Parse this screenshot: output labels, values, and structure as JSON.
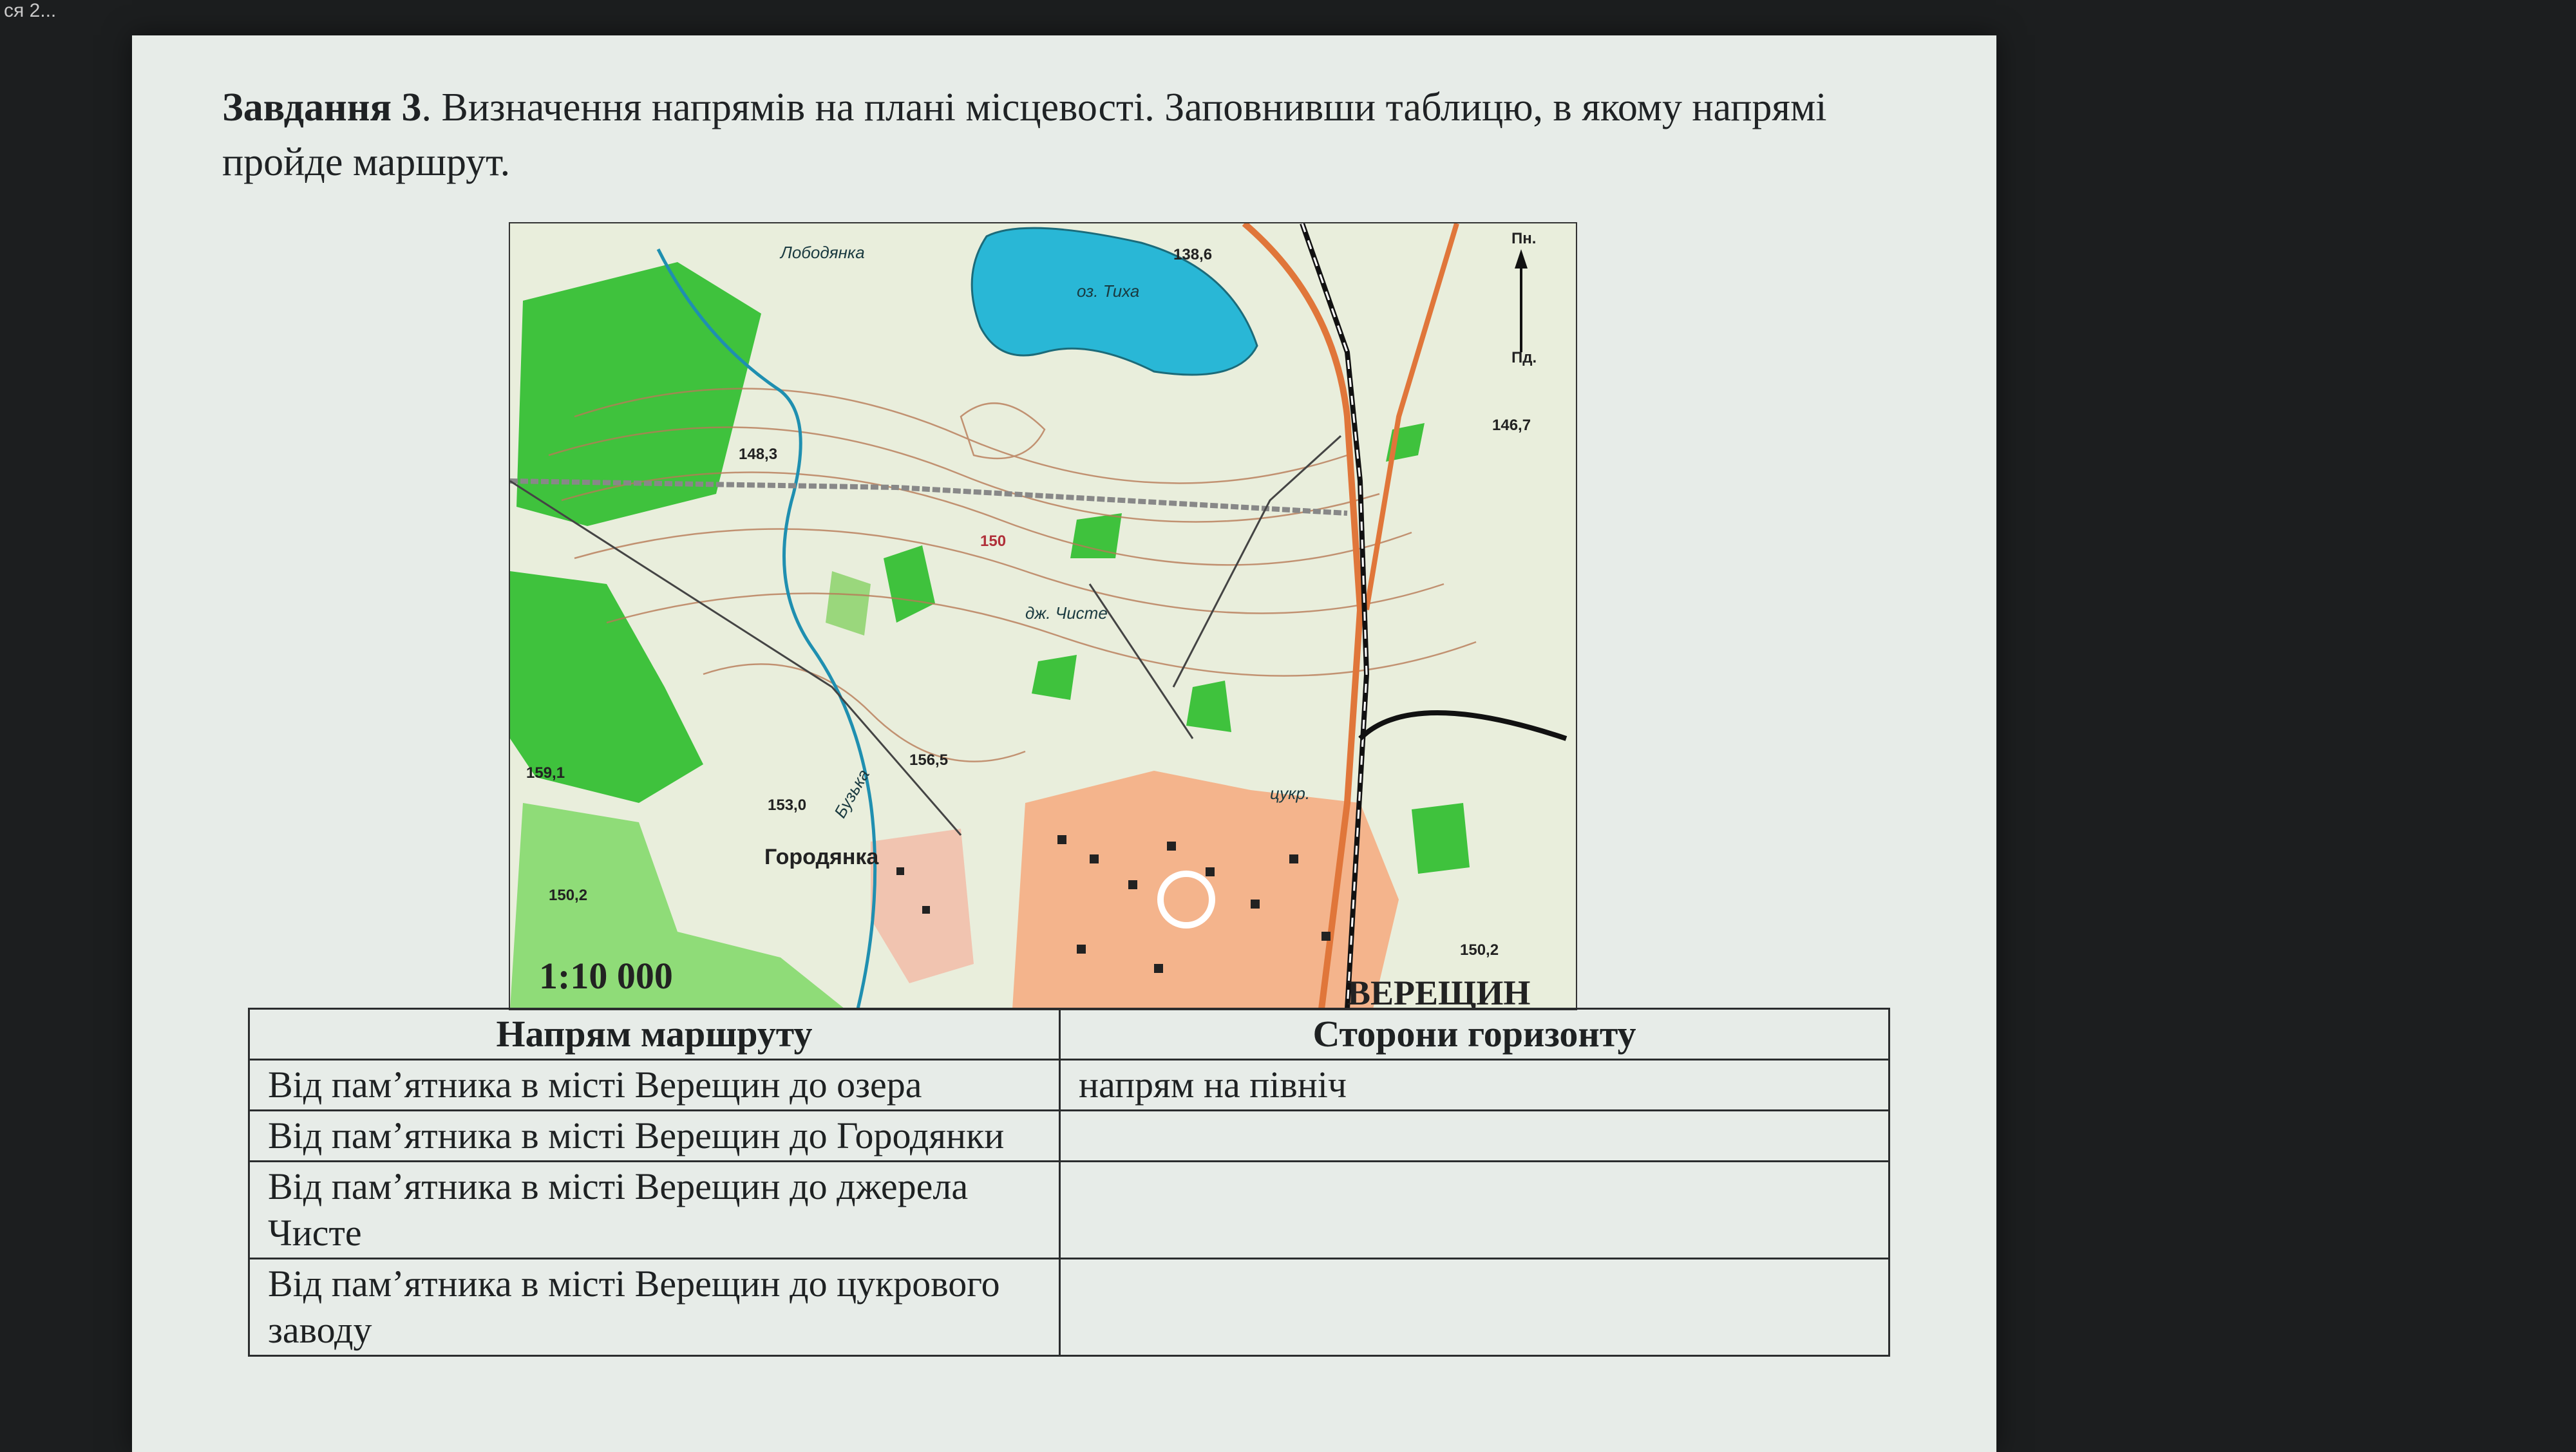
{
  "taskbar": {
    "text": "ся  2..."
  },
  "task": {
    "number_label": "Завдання 3",
    "text": ". Визначення напрямів на плані місцевості. Заповнивши таблицю, в якому напрямі пройде маршрут."
  },
  "map": {
    "scale": "1:10 000",
    "city": "ВЕРЕЩИН",
    "labels": {
      "lobodianka": "Лободянка",
      "lake": "оз. Тиха",
      "h1386": "138,6",
      "h1483": "148,3",
      "h1467": "146,7",
      "spring": "дж. Чисте",
      "h1565": "156,5",
      "h1530": "153,0",
      "h1591": "159,1",
      "h1502a": "150,2",
      "h1502b": "150,2",
      "h150": "150",
      "village": "Городянка",
      "river": "Бузька",
      "sugar": "цукр.",
      "north": "Пн.",
      "south": "Пд."
    }
  },
  "table": {
    "headers": [
      "Напрям маршруту",
      "Сторони горизонту"
    ],
    "rows": [
      {
        "route": "Від пам’ятника в місті Верещин до озера",
        "direction": "напрям на північ"
      },
      {
        "route": "Від пам’ятника в місті Верещин до Городянки",
        "direction": ""
      },
      {
        "route": "Від пам’ятника в місті Верещин до джерела Чисте",
        "direction": ""
      },
      {
        "route": "Від пам’ятника в місті Верещин до цукрового заводу",
        "direction": ""
      }
    ]
  }
}
